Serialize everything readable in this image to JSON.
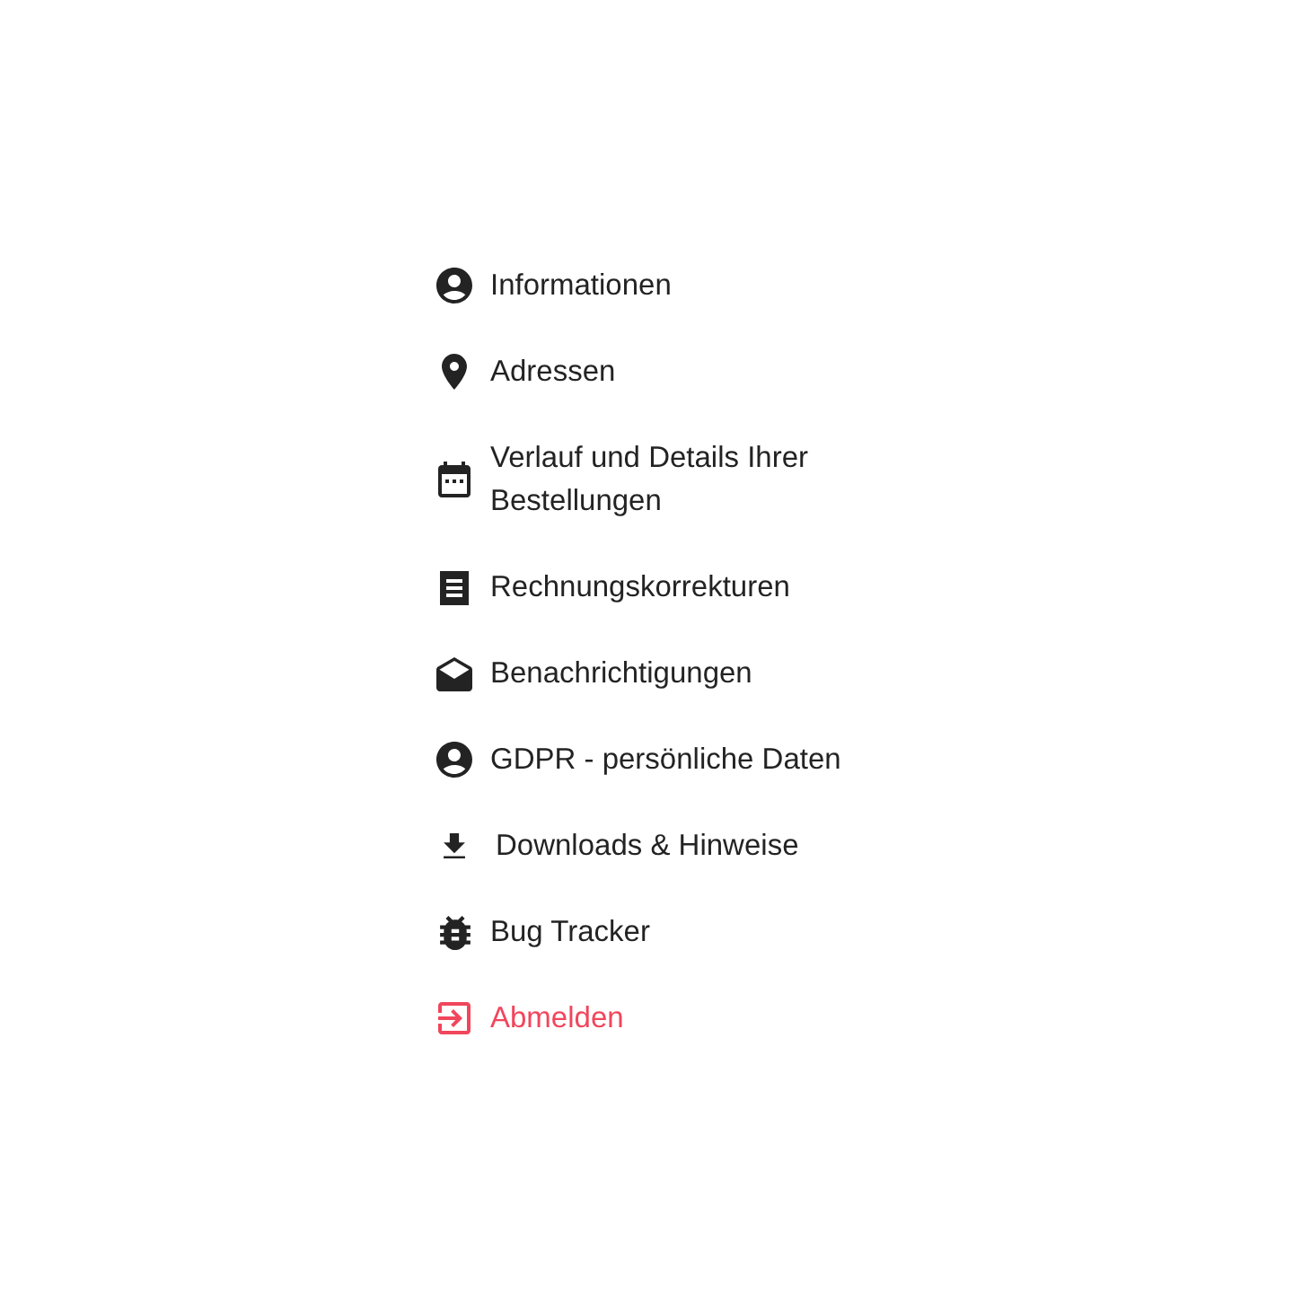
{
  "account_menu": {
    "items": [
      {
        "kind": "profile",
        "label": "Informationen"
      },
      {
        "kind": "addresses",
        "label": "Adressen"
      },
      {
        "kind": "orders",
        "label": "Verlauf und Details Ihrer Bestellungen"
      },
      {
        "kind": "invoices",
        "label": "Rechnungskorrekturen"
      },
      {
        "kind": "notifications",
        "label": "Benachrichtigungen"
      },
      {
        "kind": "privacy",
        "label": "GDPR - persönliche Daten"
      },
      {
        "kind": "downloads",
        "label": "Downloads & Hinweise"
      },
      {
        "kind": "bugs",
        "label": "Bug Tracker"
      },
      {
        "kind": "logout",
        "label": "Abmelden"
      }
    ]
  }
}
